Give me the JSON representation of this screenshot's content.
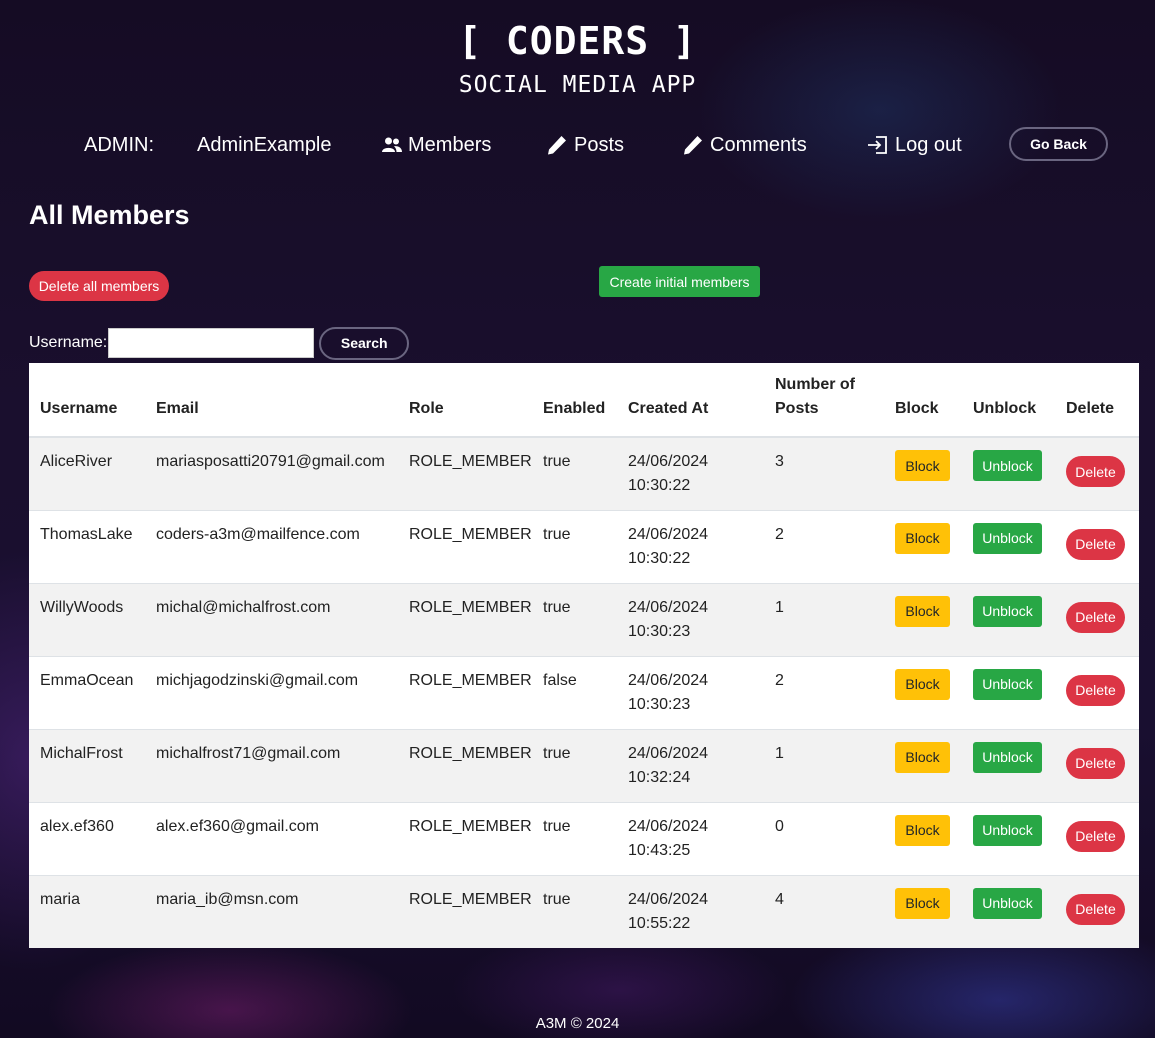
{
  "header": {
    "brand": "[ CODERS ]",
    "subtitle": "SOCIAL MEDIA APP"
  },
  "nav": {
    "admin_label": "ADMIN:",
    "admin_name": "AdminExample",
    "members": "Members",
    "posts": "Posts",
    "comments": "Comments",
    "logout": "Log out",
    "go_back": "Go Back"
  },
  "page": {
    "title": "All Members",
    "delete_all": "Delete all members",
    "create_initial": "Create initial members",
    "search_label": "Username:",
    "search_value": "",
    "search_button": "Search"
  },
  "table": {
    "headers": [
      "Username",
      "Email",
      "Role",
      "Enabled",
      "Created At",
      "Number of Posts",
      "Block",
      "Unblock",
      "Delete"
    ],
    "action_labels": {
      "block": "Block",
      "unblock": "Unblock",
      "delete": "Delete"
    },
    "rows": [
      {
        "username": "AliceRiver",
        "email": "mariasposatti20791@gmail.com",
        "role": "ROLE_MEMBER",
        "enabled": "true",
        "date": "24/06/2024",
        "time": "10:30:22",
        "posts": "3"
      },
      {
        "username": "ThomasLake",
        "email": "coders-a3m@mailfence.com",
        "role": "ROLE_MEMBER",
        "enabled": "true",
        "date": "24/06/2024",
        "time": "10:30:22",
        "posts": "2"
      },
      {
        "username": "WillyWoods",
        "email": "michal@michalfrost.com",
        "role": "ROLE_MEMBER",
        "enabled": "true",
        "date": "24/06/2024",
        "time": "10:30:23",
        "posts": "1"
      },
      {
        "username": "EmmaOcean",
        "email": "michjagodzinski@gmail.com",
        "role": "ROLE_MEMBER",
        "enabled": "false",
        "date": "24/06/2024",
        "time": "10:30:23",
        "posts": "2"
      },
      {
        "username": "MichalFrost",
        "email": "michalfrost71@gmail.com",
        "role": "ROLE_MEMBER",
        "enabled": "true",
        "date": "24/06/2024",
        "time": "10:32:24",
        "posts": "1"
      },
      {
        "username": "alex.ef360",
        "email": "alex.ef360@gmail.com",
        "role": "ROLE_MEMBER",
        "enabled": "true",
        "date": "24/06/2024",
        "time": "10:43:25",
        "posts": "0"
      },
      {
        "username": "maria",
        "email": "maria_ib@msn.com",
        "role": "ROLE_MEMBER",
        "enabled": "true",
        "date": "24/06/2024",
        "time": "10:55:22",
        "posts": "4"
      }
    ]
  },
  "footer": {
    "text": "A3M © 2024"
  },
  "colors": {
    "danger": "#dc3545",
    "success": "#28a745",
    "warning": "#ffc107",
    "background": "#1a0f2e"
  },
  "icons": {
    "members": "users-icon",
    "posts": "pencil-icon",
    "comments": "pencil-icon",
    "logout": "logout-icon"
  }
}
